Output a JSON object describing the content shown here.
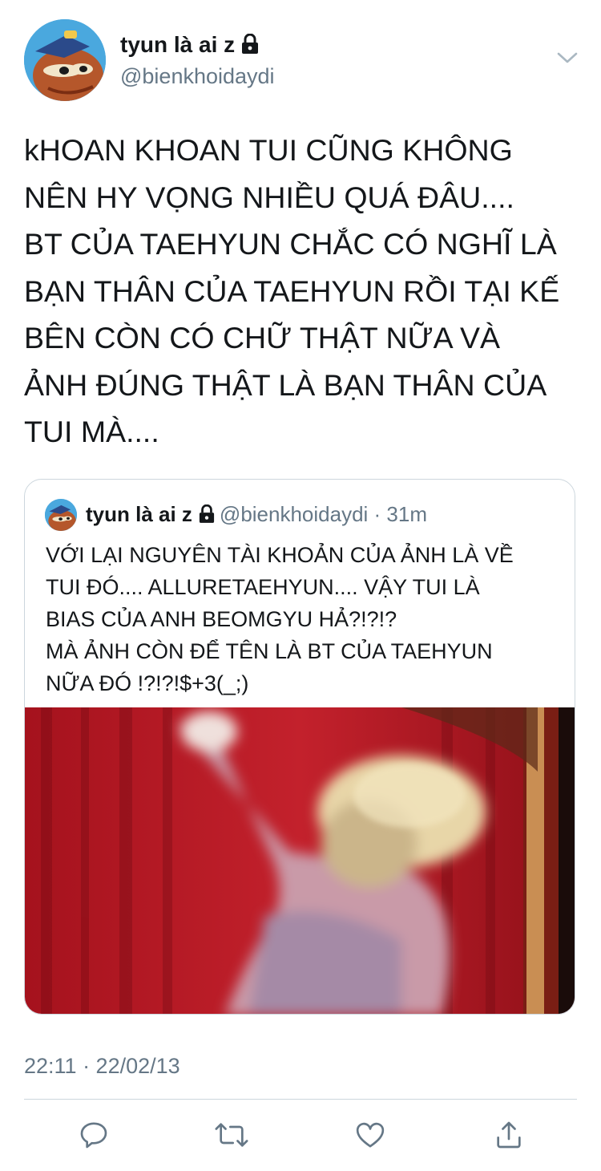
{
  "tweet": {
    "display_name": "tyun là ai z",
    "handle": "@bienkhoidaydi",
    "text": "kHOAN KHOAN TUI CŨNG KHÔNG\nNÊN HY VỌNG NHIỀU QUÁ ĐÂU....\nBT CỦA TAEHYUN CHẮC CÓ NGHĨ LÀ\nBẠN THÂN CỦA TAEHYUN RỒI TẠI KẾ\nBÊN CÒN CÓ CHỮ THẬT NỮA VÀ\nẢNH ĐÚNG THẬT LÀ BẠN THÂN CỦA\nTUI MÀ....",
    "timestamp": "22:11 · 22/02/13"
  },
  "quote": {
    "display_name": "tyun là ai z",
    "handle_time": "@bienkhoidaydi · 31m",
    "text": "VỚI LẠI NGUYÊN TÀI KHOẢN CỦA ẢNH LÀ VỀ\nTUI ĐÓ.... ALLURETAEHYUN.... VẬY TUI LÀ\nBIAS CỦA ANH BEOMGYU HẢ?!?!?\nMÀ ẢNH CÒN ĐỂ TÊN LÀ BT CỦA TAEHYUN\nNỮA ĐÓ !?!?!$+3(_;)"
  },
  "icons": {
    "caret": "chevron-down-icon",
    "lock": "lock-icon",
    "reply": "reply-icon",
    "retweet": "retweet-icon",
    "like": "heart-icon",
    "share": "share-icon"
  },
  "colors": {
    "text": "#14171a",
    "secondary": "#657786",
    "border": "#ccd6dd",
    "action_icon": "#1da1f2"
  }
}
